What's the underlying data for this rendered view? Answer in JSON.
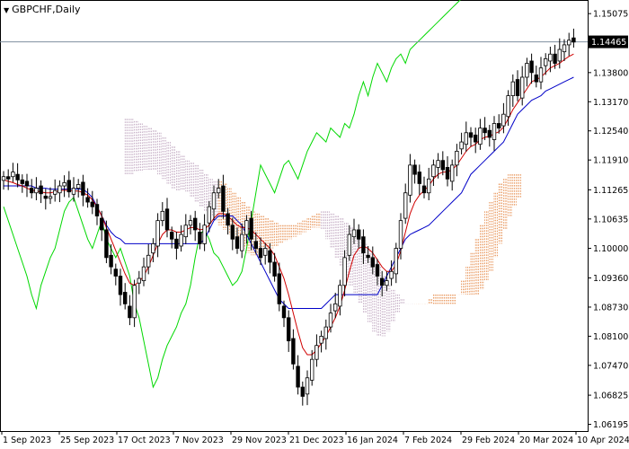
{
  "window": {
    "symbol_label": "GBPCHF,Daily",
    "dropdown_icon": "triangle-down-icon"
  },
  "chart_data": {
    "type": "candlestick",
    "symbol": "GBPCHF",
    "timeframe": "Daily",
    "current_price": "1.14465",
    "ylim": [
      1.0605,
      1.1535
    ],
    "x_labels": [
      "1 Sep 2023",
      "25 Sep 2023",
      "17 Oct 2023",
      "7 Nov 2023",
      "29 Nov 2023",
      "21 Dec 2023",
      "16 Jan 2024",
      "7 Feb 2024",
      "29 Feb 2024",
      "20 Mar 2024",
      "10 Apr 2024"
    ],
    "y_ticks": [
      "1.15075",
      "1.13800",
      "1.13170",
      "1.12540",
      "1.11910",
      "1.11265",
      "1.10635",
      "1.10000",
      "1.09360",
      "1.08730",
      "1.08100",
      "1.07470",
      "1.06825",
      "1.06195"
    ],
    "indicators": {
      "tenkan_color": "#d00000",
      "kijun_color": "#0000c8",
      "chikou_color": "#00d800",
      "cloud_bull_color": "#e07020",
      "cloud_bear_color": "#b090b0"
    },
    "close": [
      1.1155,
      1.115,
      1.1165,
      1.1148,
      1.114,
      1.1135,
      1.112,
      1.113,
      1.1118,
      1.1108,
      1.1112,
      1.1125,
      1.1135,
      1.1142,
      1.1122,
      1.113,
      1.1138,
      1.1115,
      1.11,
      1.109,
      1.107,
      1.104,
      1.098,
      1.096,
      1.094,
      1.09,
      1.088,
      1.085,
      1.092,
      1.0935,
      1.096,
      1.0985,
      1.101,
      1.106,
      1.108,
      1.104,
      1.102,
      1.1,
      1.103,
      1.105,
      1.106,
      1.104,
      1.101,
      1.105,
      1.109,
      1.112,
      1.113,
      1.108,
      1.105,
      1.102,
      1.1,
      1.103,
      1.106,
      1.102,
      1.1,
      1.098,
      1.1,
      1.097,
      1.094,
      1.088,
      1.085,
      1.08,
      1.075,
      1.07,
      1.068,
      1.072,
      1.076,
      1.079,
      1.081,
      1.083,
      1.086,
      1.088,
      1.092,
      1.098,
      1.103,
      1.104,
      1.102,
      1.099,
      1.098,
      1.096,
      1.094,
      1.092,
      1.093,
      1.095,
      1.1,
      1.106,
      1.112,
      1.118,
      1.116,
      1.114,
      1.112,
      1.115,
      1.118,
      1.119,
      1.117,
      1.115,
      1.118,
      1.121,
      1.123,
      1.125,
      1.124,
      1.123,
      1.126,
      1.125,
      1.124,
      1.127,
      1.126,
      1.129,
      1.133,
      1.136,
      1.133,
      1.137,
      1.14,
      1.138,
      1.136,
      1.139,
      1.141,
      1.142,
      1.14,
      1.143,
      1.144,
      1.145,
      1.1446
    ],
    "tenkan": [
      1.1148,
      1.1145,
      1.1142,
      1.1138,
      1.1135,
      1.113,
      1.1126,
      1.1124,
      1.1122,
      1.112,
      1.112,
      1.1122,
      1.1125,
      1.1126,
      1.1125,
      1.1124,
      1.1124,
      1.112,
      1.1115,
      1.1105,
      1.109,
      1.107,
      1.1045,
      1.102,
      1.0995,
      1.097,
      1.0945,
      1.0925,
      1.092,
      1.0928,
      1.094,
      1.096,
      1.0985,
      1.101,
      1.103,
      1.104,
      1.104,
      1.1035,
      1.1035,
      1.104,
      1.1045,
      1.1045,
      1.104,
      1.1042,
      1.105,
      1.1065,
      1.1075,
      1.1075,
      1.107,
      1.106,
      1.105,
      1.1045,
      1.1045,
      1.104,
      1.103,
      1.102,
      1.101,
      1.1,
      1.0985,
      1.096,
      1.0935,
      1.09,
      1.086,
      1.082,
      1.0785,
      1.077,
      1.077,
      1.078,
      1.0795,
      1.081,
      1.083,
      1.085,
      1.0875,
      1.091,
      1.095,
      1.0985,
      1.1,
      1.1005,
      1.1,
      1.099,
      1.0975,
      1.096,
      1.095,
      1.095,
      1.0965,
      1.0995,
      1.1035,
      1.1075,
      1.11,
      1.1115,
      1.1125,
      1.1135,
      1.115,
      1.116,
      1.1165,
      1.1165,
      1.117,
      1.118,
      1.1195,
      1.121,
      1.122,
      1.1225,
      1.1235,
      1.124,
      1.1242,
      1.1248,
      1.1252,
      1.1262,
      1.128,
      1.13,
      1.1315,
      1.133,
      1.1345,
      1.136,
      1.1365,
      1.137,
      1.138,
      1.139,
      1.1395,
      1.14,
      1.1408,
      1.1415,
      1.142
    ],
    "kijun": [
      1.1135,
      1.1135,
      1.1135,
      1.1135,
      1.1135,
      1.1135,
      1.1135,
      1.113,
      1.113,
      1.113,
      1.1128,
      1.1128,
      1.1128,
      1.1128,
      1.1128,
      1.1128,
      1.1128,
      1.1128,
      1.112,
      1.111,
      1.109,
      1.107,
      1.105,
      1.1035,
      1.1025,
      1.102,
      1.101,
      1.101,
      1.101,
      1.101,
      1.101,
      1.101,
      1.101,
      1.101,
      1.101,
      1.101,
      1.101,
      1.101,
      1.101,
      1.101,
      1.101,
      1.101,
      1.101,
      1.102,
      1.104,
      1.106,
      1.107,
      1.107,
      1.107,
      1.107,
      1.106,
      1.105,
      1.103,
      1.101,
      1.099,
      1.097,
      1.095,
      1.093,
      1.091,
      1.089,
      1.088,
      1.087,
      1.087,
      1.087,
      1.087,
      1.087,
      1.087,
      1.087,
      1.087,
      1.088,
      1.089,
      1.09,
      1.09,
      1.09,
      1.09,
      1.09,
      1.09,
      1.09,
      1.09,
      1.09,
      1.09,
      1.092,
      1.094,
      1.096,
      1.098,
      1.1,
      1.102,
      1.103,
      1.1035,
      1.104,
      1.1045,
      1.105,
      1.106,
      1.107,
      1.108,
      1.109,
      1.11,
      1.111,
      1.112,
      1.114,
      1.116,
      1.117,
      1.118,
      1.119,
      1.12,
      1.121,
      1.122,
      1.123,
      1.125,
      1.127,
      1.129,
      1.13,
      1.131,
      1.132,
      1.1325,
      1.133,
      1.134,
      1.1345,
      1.135,
      1.1355,
      1.136,
      1.1365,
      1.137
    ],
    "chikou": [
      1.109,
      1.106,
      1.103,
      1.1,
      1.097,
      1.094,
      1.09,
      1.087,
      1.092,
      1.095,
      1.098,
      1.1,
      1.104,
      1.108,
      1.11,
      1.111,
      1.108,
      1.105,
      1.102,
      1.1,
      1.103,
      1.106,
      1.102,
      1.1,
      1.098,
      1.1,
      1.097,
      1.094,
      1.088,
      1.085,
      1.08,
      1.075,
      1.07,
      1.072,
      1.076,
      1.079,
      1.081,
      1.083,
      1.086,
      1.088,
      1.092,
      1.098,
      1.103,
      1.104,
      1.102,
      1.099,
      1.098,
      1.096,
      1.094,
      1.092,
      1.093,
      1.095,
      1.1,
      1.106,
      1.112,
      1.118,
      1.116,
      1.114,
      1.112,
      1.115,
      1.118,
      1.119,
      1.117,
      1.115,
      1.118,
      1.121,
      1.123,
      1.125,
      1.124,
      1.123,
      1.126,
      1.125,
      1.124,
      1.127,
      1.126,
      1.129,
      1.133,
      1.136,
      1.133,
      1.137,
      1.14,
      1.138,
      1.136,
      1.139,
      1.141,
      1.142,
      1.14,
      1.143,
      1.144,
      1.145,
      1.146,
      1.147,
      1.148,
      1.149,
      1.15,
      1.151,
      1.152,
      1.153,
      1.154,
      1.155
    ],
    "cloud": {
      "top": [
        1.128,
        1.128,
        1.1275,
        1.127,
        1.1265,
        1.126,
        1.1255,
        1.125,
        1.124,
        1.123,
        1.122,
        1.121,
        1.12,
        1.119,
        1.1185,
        1.118,
        1.117,
        1.116,
        1.115,
        1.1145,
        1.1145,
        1.114,
        1.113,
        1.112,
        1.111,
        1.11,
        1.109,
        1.108,
        1.1075,
        1.107,
        1.1065,
        1.106,
        1.1055,
        1.105,
        1.105,
        1.105,
        1.105,
        1.1055,
        1.106,
        1.1065,
        1.107,
        1.1075,
        1.108,
        1.108,
        1.1075,
        1.107,
        1.1065,
        1.1055,
        1.1045,
        1.1035,
        1.1025,
        1.101,
        1.0995,
        1.098,
        1.096,
        1.094,
        1.092,
        1.091,
        1.09,
        1.089,
        1.088,
        1.088,
        1.088,
        1.088,
        1.088,
        1.088,
        1.088,
        1.088,
        1.088,
        1.088,
        1.088,
        1.09,
        1.093,
        1.096,
        1.099,
        1.102,
        1.105,
        1.108,
        1.11,
        1.112,
        1.114,
        1.115,
        1.116,
        1.116,
        1.116,
        1.116
      ],
      "bottom": [
        1.116,
        1.116,
        1.1165,
        1.1165,
        1.117,
        1.117,
        1.117,
        1.116,
        1.115,
        1.114,
        1.113,
        1.1125,
        1.1125,
        1.112,
        1.111,
        1.11,
        1.109,
        1.108,
        1.107,
        1.106,
        1.105,
        1.104,
        1.103,
        1.102,
        1.101,
        1.1,
        1.099,
        1.0985,
        1.0985,
        1.099,
        1.0995,
        1.1,
        1.1005,
        1.101,
        1.1015,
        1.102,
        1.1025,
        1.103,
        1.1035,
        1.104,
        1.1045,
        1.1045,
        1.104,
        1.102,
        1.1,
        1.098,
        1.096,
        1.094,
        1.092,
        1.09,
        1.088,
        1.086,
        1.084,
        1.082,
        1.081,
        1.081,
        1.082,
        1.084,
        1.086,
        1.088,
        1.088,
        1.088,
        1.088,
        1.088,
        1.088,
        1.089,
        1.09,
        1.09,
        1.09,
        1.09,
        1.09,
        1.09,
        1.09,
        1.09,
        1.09,
        1.09,
        1.091,
        1.093,
        1.095,
        1.098,
        1.101,
        1.104,
        1.107,
        1.109,
        1.111,
        1.112
      ]
    }
  }
}
